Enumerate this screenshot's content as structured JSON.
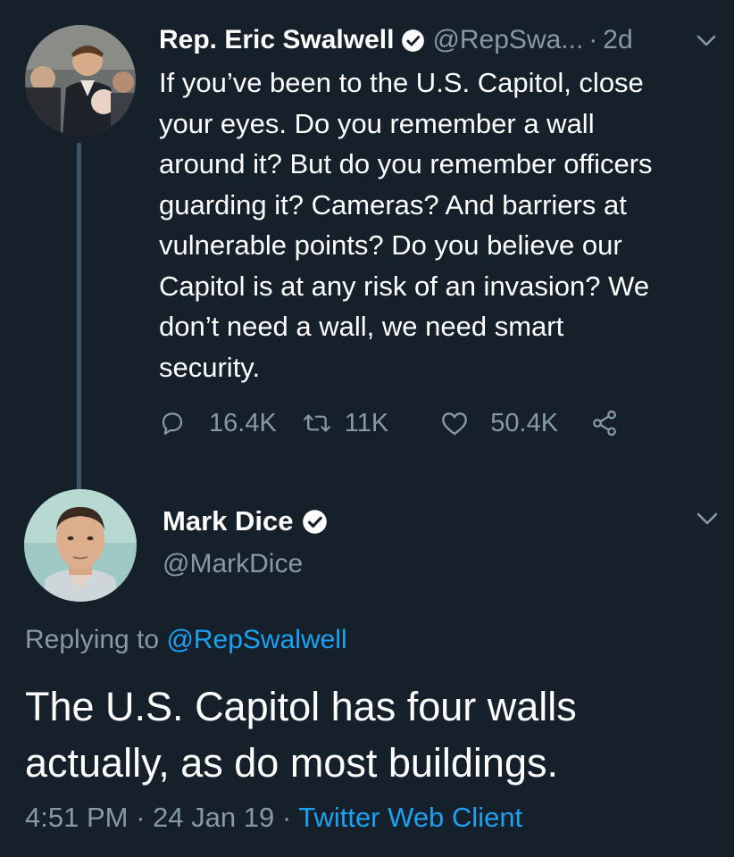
{
  "tweet1": {
    "name": "Rep. Eric Swalwell",
    "handle": "@RepSwa...",
    "time": "2d",
    "separator": "·",
    "text_lines": [
      "If you’ve been to the U.S. Capitol,  close",
      "your eyes. Do you remember a wall",
      "around it? But do you remember officers",
      "guarding it? Cameras? And barriers at",
      "vulnerable points? Do you believe our",
      "Capitol is at any risk of an invasion? We",
      "don’t need a wall, we need smart",
      "security."
    ],
    "replies": "16.4K",
    "retweets": "11K",
    "likes": "50.4K",
    "icons": [
      "reply-icon",
      "retweet-icon",
      "like-icon",
      "share-icon",
      "verified-icon",
      "chevron-down-icon"
    ]
  },
  "tweet2": {
    "name": "Mark Dice",
    "handle": "@MarkDice",
    "replying_prefix": "Replying to",
    "replying_handle": "@RepSwalwell",
    "text_lines": [
      "The U.S. Capitol has four walls",
      "actually, as do most buildings."
    ],
    "time": "4:51 PM",
    "date": "24 Jan 19",
    "separator": "·",
    "client": "Twitter Web Client"
  },
  "colors": {
    "background": "#15202b",
    "secondary_text": "#8899a6",
    "link": "#1da1f2",
    "thread_line": "#3d5466"
  }
}
